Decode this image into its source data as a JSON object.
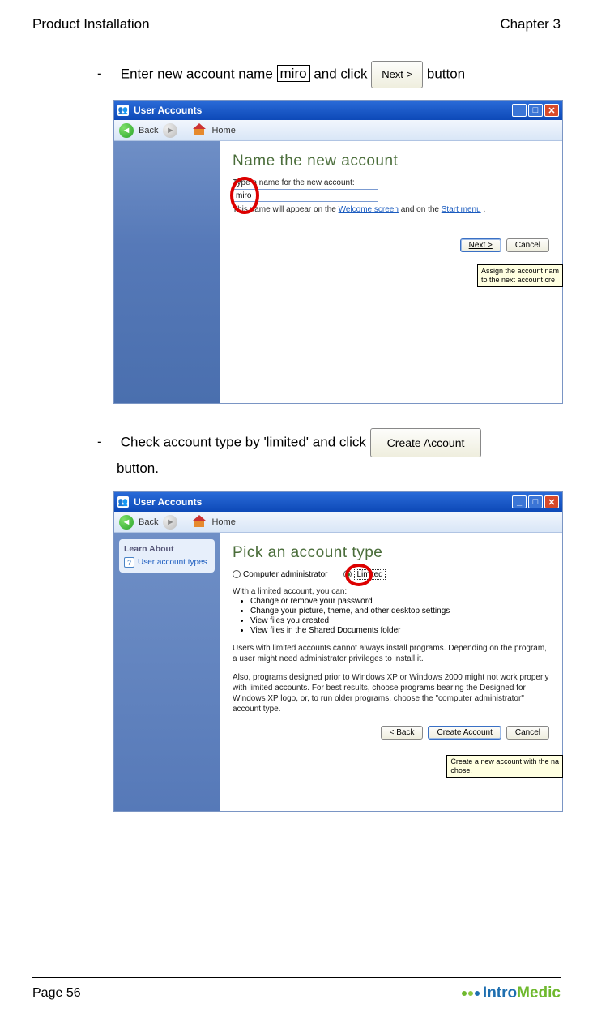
{
  "doc": {
    "header_left": "Product Installation",
    "header_right": "Chapter 3",
    "instr1_pre": "Enter new account name ",
    "instr1_boxed": "miro",
    "instr1_mid": " and click  ",
    "instr1_btn": "Next >",
    "instr1_post": "  button",
    "instr2_pre": "Check account type by 'limited' and click  ",
    "instr2_btn": "Create Account",
    "instr2_post": "button.",
    "page_label": "Page 56",
    "brand_a": "Intro",
    "brand_b": "Medic"
  },
  "ss1": {
    "title": "User Accounts",
    "nav_back": "Back",
    "nav_home": "Home",
    "heading": "Name the new account",
    "label": "Type a name for the new account:",
    "input_value": "miro",
    "hint_pre": "This name will appear on the ",
    "hint_link1": "Welcome screen",
    "hint_mid": " and on the ",
    "hint_link2": "Start menu",
    "hint_post": ".",
    "btn_next": "Next >",
    "btn_cancel": "Cancel",
    "tooltip_l1": "Assign the account nam",
    "tooltip_l2": "to the next account cre"
  },
  "ss2": {
    "title": "User Accounts",
    "nav_back": "Back",
    "nav_home": "Home",
    "learn_title": "Learn About",
    "learn_link": "User account types",
    "heading": "Pick an account type",
    "radio_admin": "Computer administrator",
    "radio_limited": "Limited",
    "limited_intro": "With a limited account, you can:",
    "bullets": [
      "Change or remove your password",
      "Change your picture, theme, and other desktop settings",
      "View files you created",
      "View files in the Shared Documents folder"
    ],
    "p1": "Users with limited accounts cannot always install programs. Depending on the program, a user might need administrator privileges to install it.",
    "p2": "Also, programs designed prior to Windows XP or Windows 2000 might not work properly with limited accounts. For best results, choose programs bearing the Designed for Windows XP logo, or, to run older programs, choose the \"computer administrator\" account type.",
    "btn_back": "< Back",
    "btn_create": "Create Account",
    "btn_cancel": "Cancel",
    "tooltip_l1": "Create a new account with the na",
    "tooltip_l2": "chose."
  }
}
